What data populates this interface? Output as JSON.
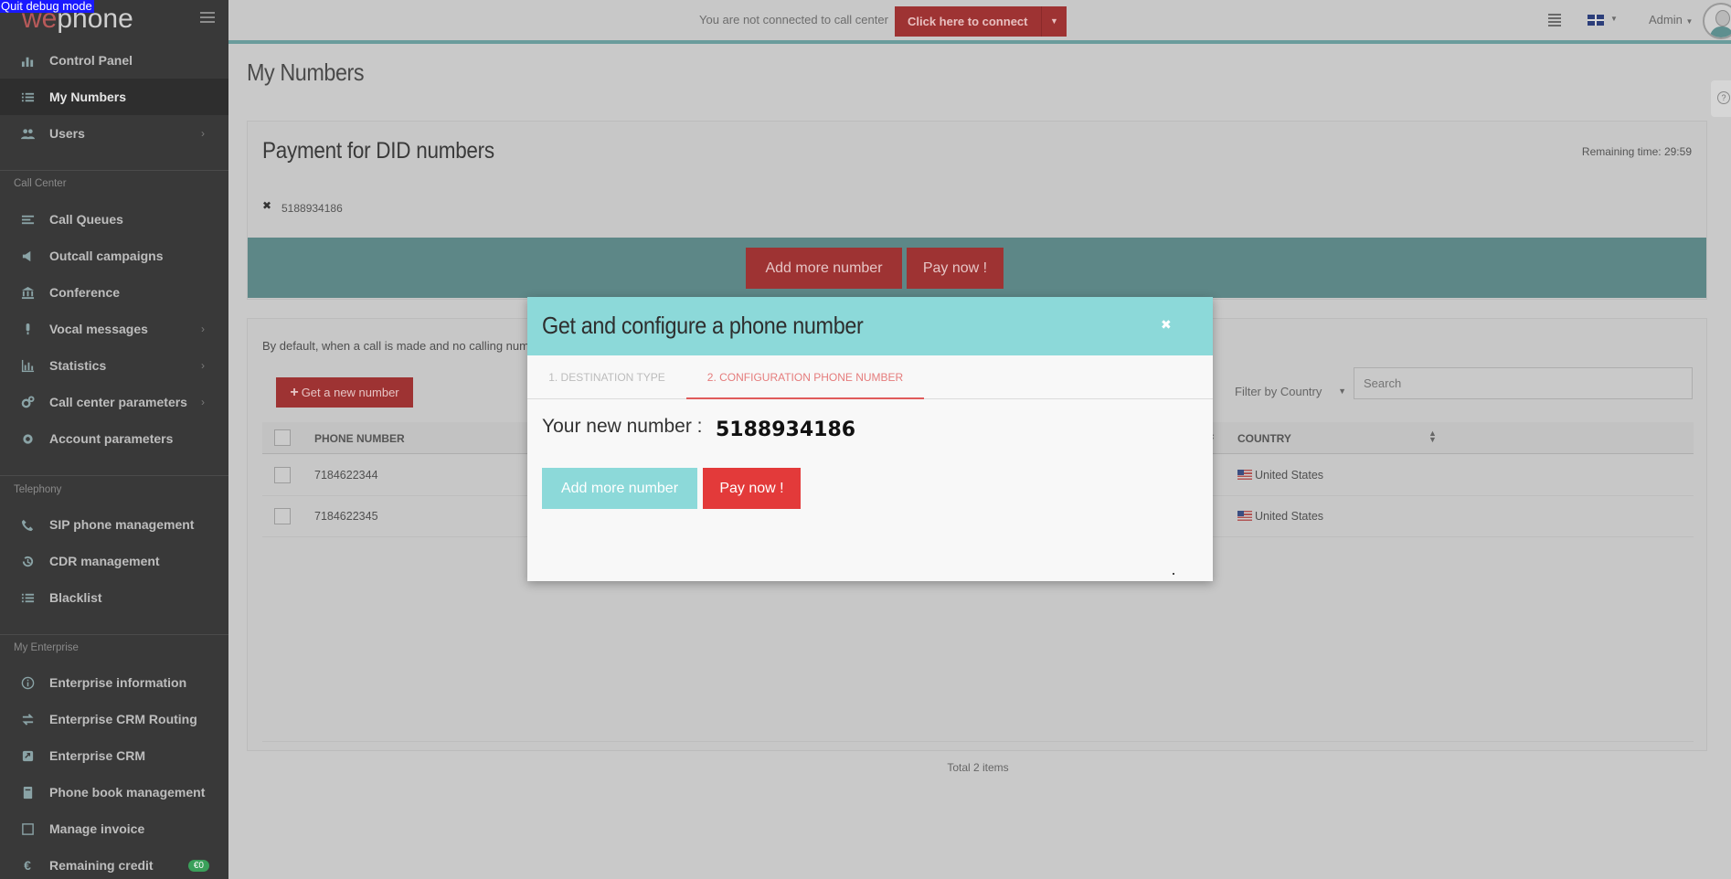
{
  "debug": {
    "label": "Quit debug mode"
  },
  "brand": {
    "logo_we": "we",
    "logo_phone": "phone"
  },
  "sidebar": {
    "items": [
      {
        "label": "Control Panel",
        "icon": "bar-chart-icon"
      },
      {
        "label": "My Numbers",
        "icon": "list-icon"
      },
      {
        "label": "Users",
        "icon": "users-icon"
      },
      {
        "label": "Call Queues",
        "icon": "queue-icon"
      },
      {
        "label": "Outcall campaigns",
        "icon": "megaphone-icon"
      },
      {
        "label": "Conference",
        "icon": "institution-icon"
      },
      {
        "label": "Vocal messages",
        "icon": "microphone-icon"
      },
      {
        "label": "Statistics",
        "icon": "statistics-icon"
      },
      {
        "label": "Call center parameters",
        "icon": "cogs-icon"
      },
      {
        "label": "Account parameters",
        "icon": "gear-icon"
      },
      {
        "label": "SIP phone management",
        "icon": "phone-icon"
      },
      {
        "label": "CDR management",
        "icon": "history-icon"
      },
      {
        "label": "Blacklist",
        "icon": "list-icon"
      },
      {
        "label": "Enterprise information",
        "icon": "info-icon"
      },
      {
        "label": "Enterprise CRM Routing",
        "icon": "exchange-icon"
      },
      {
        "label": "Enterprise CRM",
        "icon": "share-square-icon"
      },
      {
        "label": "Phone book management",
        "icon": "book-icon"
      },
      {
        "label": "Manage invoice",
        "icon": "invoice-icon"
      },
      {
        "label": "Remaining credit",
        "icon": "euro-icon"
      }
    ],
    "sections": {
      "call_center": "Call Center",
      "telephony": "Telephony",
      "enterprise": "My Enterprise"
    },
    "credit_badge": "€0"
  },
  "topbar": {
    "connect_text": "You are not connected to call center",
    "connect_button": "Click here to connect",
    "admin_label": "Admin"
  },
  "page": {
    "title": "My Numbers"
  },
  "payment": {
    "title": "Payment for DID numbers",
    "remaining": "Remaining time: 29:59",
    "number": "5188934186",
    "add_more": "Add more number",
    "pay_now": "Pay now !"
  },
  "numbers": {
    "default_text": "By default, when a call is made and no calling num",
    "get_new": "Get a new number",
    "filter_country": "Filter by Country",
    "search_placeholder": "Search",
    "columns": {
      "phone": "PHONE NUMBER",
      "country": "COUNTRY"
    },
    "rows": [
      {
        "phone": "7184622344",
        "country": "United States"
      },
      {
        "phone": "7184622345",
        "country": "United States"
      }
    ],
    "total": "Total 2 items"
  },
  "modal": {
    "title": "Get and configure a phone number",
    "tab1": "1. DESTINATION TYPE",
    "tab2": "2. CONFIGURATION PHONE NUMBER",
    "new_number_label": "Your new number :",
    "new_number": "5188934186",
    "add_more": "Add more number",
    "pay_now": "Pay now !"
  }
}
